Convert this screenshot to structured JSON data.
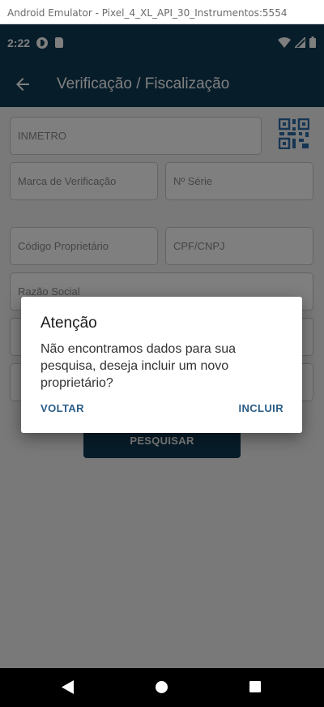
{
  "window": {
    "title": "Android Emulator - Pixel_4_XL_API_30_Instrumentos:5554"
  },
  "status_bar": {
    "time": "2:22"
  },
  "app_bar": {
    "title": "Verificação / Fiscalização",
    "back_icon": "arrow-left-icon"
  },
  "form": {
    "inmetro_placeholder": "INMETRO",
    "marca_placeholder": "Marca de Verificação",
    "serie_placeholder": "Nº Série",
    "codigo_proprietario_placeholder": "Código Proprietário",
    "cpf_cnpj_placeholder": "CPF/CNPJ",
    "razao_social_placeholder": "Razão Social",
    "search_label": "PESQUISAR"
  },
  "dialog": {
    "title": "Atenção",
    "message": "Não encontramos dados para sua pesquisa, deseja incluir um novo proprietário?",
    "cancel_label": "VOLTAR",
    "confirm_label": "INCLUIR"
  },
  "colors": {
    "primary": "#0f3a55",
    "dialog_button": "#2a5d86"
  }
}
